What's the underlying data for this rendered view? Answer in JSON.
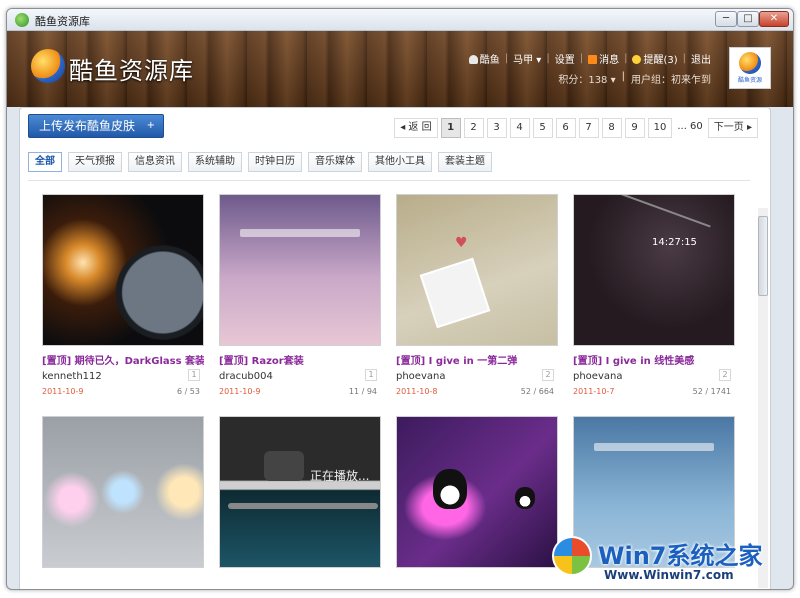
{
  "window": {
    "title": "酷鱼资源库",
    "min_label": "─",
    "max_label": "□",
    "close_label": "✕"
  },
  "header": {
    "brand": "酷鱼资源库",
    "nav": {
      "user": "酷鱼",
      "horse": "马甲 ▾",
      "settings": "设置",
      "messages": "消息",
      "reminder": "提醒(3)",
      "logout": "退出"
    },
    "points": "积分：138 ▾",
    "group": "用户组：初来乍到",
    "avatar_caption": "酷鱼资源"
  },
  "toolbar": {
    "upload_label": "上传发布酷鱼皮肤",
    "upload_plus": "+"
  },
  "pager": {
    "prev": "◂ 返 回",
    "pages": [
      "1",
      "2",
      "3",
      "4",
      "5",
      "6",
      "7",
      "8",
      "9",
      "10"
    ],
    "ellipsis": "... 60",
    "next": "下一页 ▸",
    "current": "1"
  },
  "categories": [
    "全部",
    "天气预报",
    "信息资讯",
    "系统辅助",
    "时钟日历",
    "音乐媒体",
    "其他小工具",
    "套装主题"
  ],
  "cards": [
    {
      "title": "[置顶] 期待已久，DarkGlass 套装",
      "author": "kenneth112",
      "badge": "1",
      "date": "2011-10-9",
      "stats": "6 / 53"
    },
    {
      "title": "[置顶] Razor套装",
      "author": "dracub004",
      "badge": "1",
      "date": "2011-10-9",
      "stats": "11 / 94"
    },
    {
      "title": "[置顶] I give in 一第二弹",
      "author": "phoevana",
      "badge": "2",
      "date": "2011-10-8",
      "stats": "52 / 664"
    },
    {
      "title": "[置顶] I give in 线性美感",
      "author": "phoevana",
      "badge": "2",
      "date": "2011-10-7",
      "stats": "52 / 1741"
    }
  ],
  "second_row": {
    "player_text": "正在播放..."
  },
  "watermark": {
    "text": "Win7系统之家",
    "url": "Www.Winwin7.com"
  }
}
